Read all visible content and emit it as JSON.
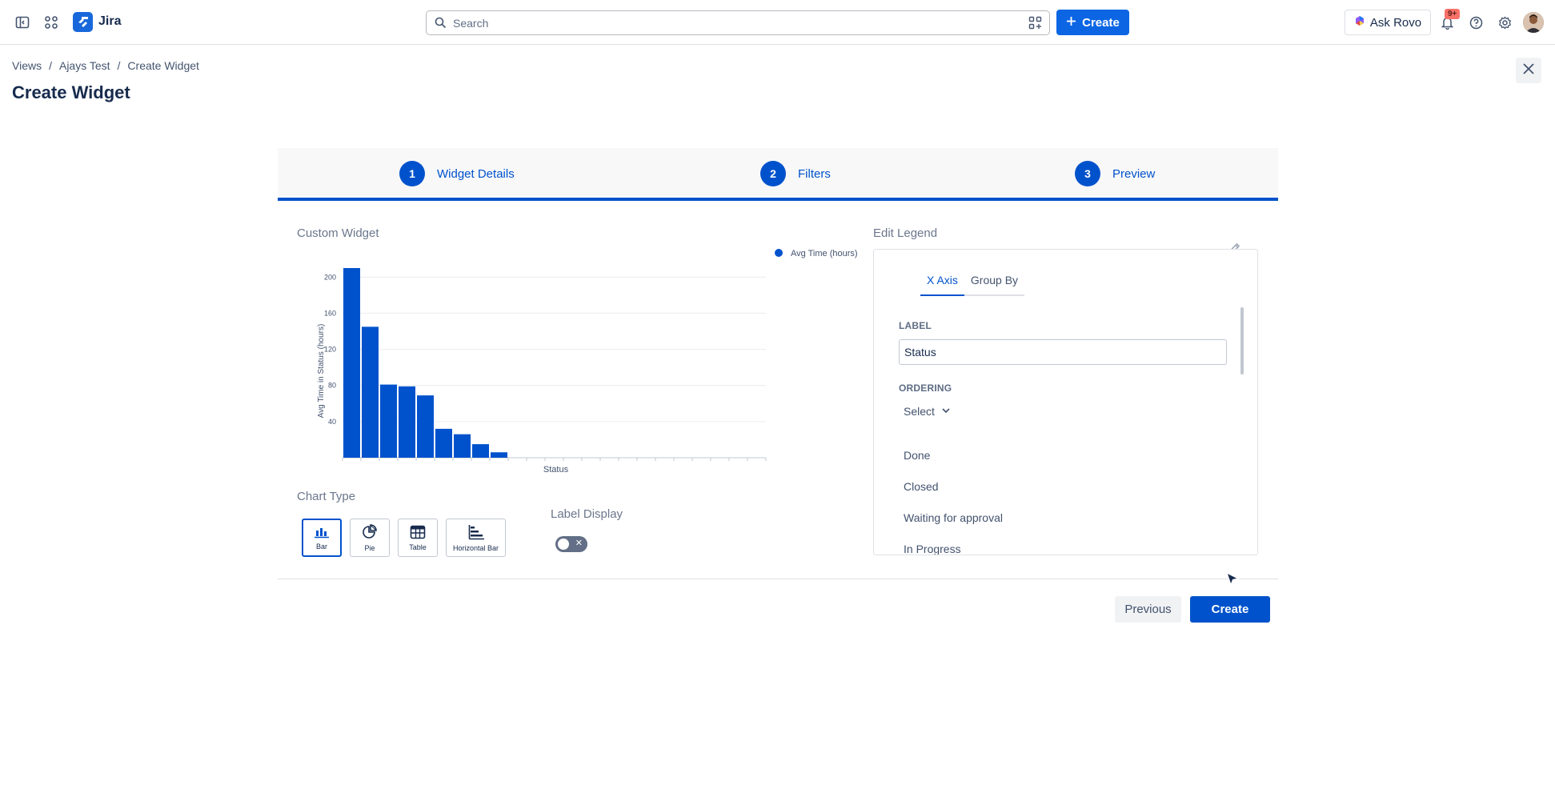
{
  "topbar": {
    "app_name": "Jira",
    "search_placeholder": "Search",
    "create_label": "Create",
    "ask_rovo_label": "Ask Rovo",
    "notification_count": "9+"
  },
  "breadcrumb": [
    "Views",
    "Ajays Test",
    "Create Widget"
  ],
  "page_title": "Create Widget",
  "stepper": {
    "steps": [
      {
        "number": "1",
        "label": "Widget Details"
      },
      {
        "number": "2",
        "label": "Filters"
      },
      {
        "number": "3",
        "label": "Preview"
      }
    ]
  },
  "widget": {
    "title": "Custom Widget",
    "chart_type_label": "Chart Type",
    "label_display_label": "Label Display",
    "label_display_on": false,
    "chart_types": [
      {
        "label": "Bar",
        "icon": "bar-chart-icon",
        "selected": true
      },
      {
        "label": "Pie",
        "icon": "pie-chart-icon",
        "selected": false
      },
      {
        "label": "Table",
        "icon": "table-icon",
        "selected": false
      },
      {
        "label": "Horizontal Bar",
        "icon": "horizontal-bar-icon",
        "selected": false
      }
    ]
  },
  "chart_data": {
    "type": "bar",
    "xlabel": "Status",
    "ylabel": "Avg Time in Status (hours)",
    "ylim": [
      0,
      210
    ],
    "yticks": [
      40,
      80,
      120,
      160,
      200
    ],
    "grid": true,
    "legend_position": "top-right",
    "series": [
      {
        "name": "Avg Time (hours)",
        "color": "#0052cc",
        "values": [
          210,
          145,
          81,
          79,
          69,
          32,
          26,
          15,
          6
        ]
      }
    ],
    "empty_slots": 14
  },
  "legend_editor": {
    "title": "Edit Legend",
    "tabs": [
      {
        "label": "X Axis",
        "active": true
      },
      {
        "label": "Group By",
        "active": false
      }
    ],
    "label_field_label": "LABEL",
    "label_value": "Status",
    "ordering_label": "ORDERING",
    "ordering_select": "Select",
    "ordering_items": [
      "Done",
      "Closed",
      "Waiting for approval",
      "In Progress"
    ]
  },
  "footer": {
    "previous_label": "Previous",
    "create_label": "Create"
  },
  "colors": {
    "primary": "#0052cc",
    "topbar_create": "#0c66e4",
    "badge": "#f87168"
  }
}
